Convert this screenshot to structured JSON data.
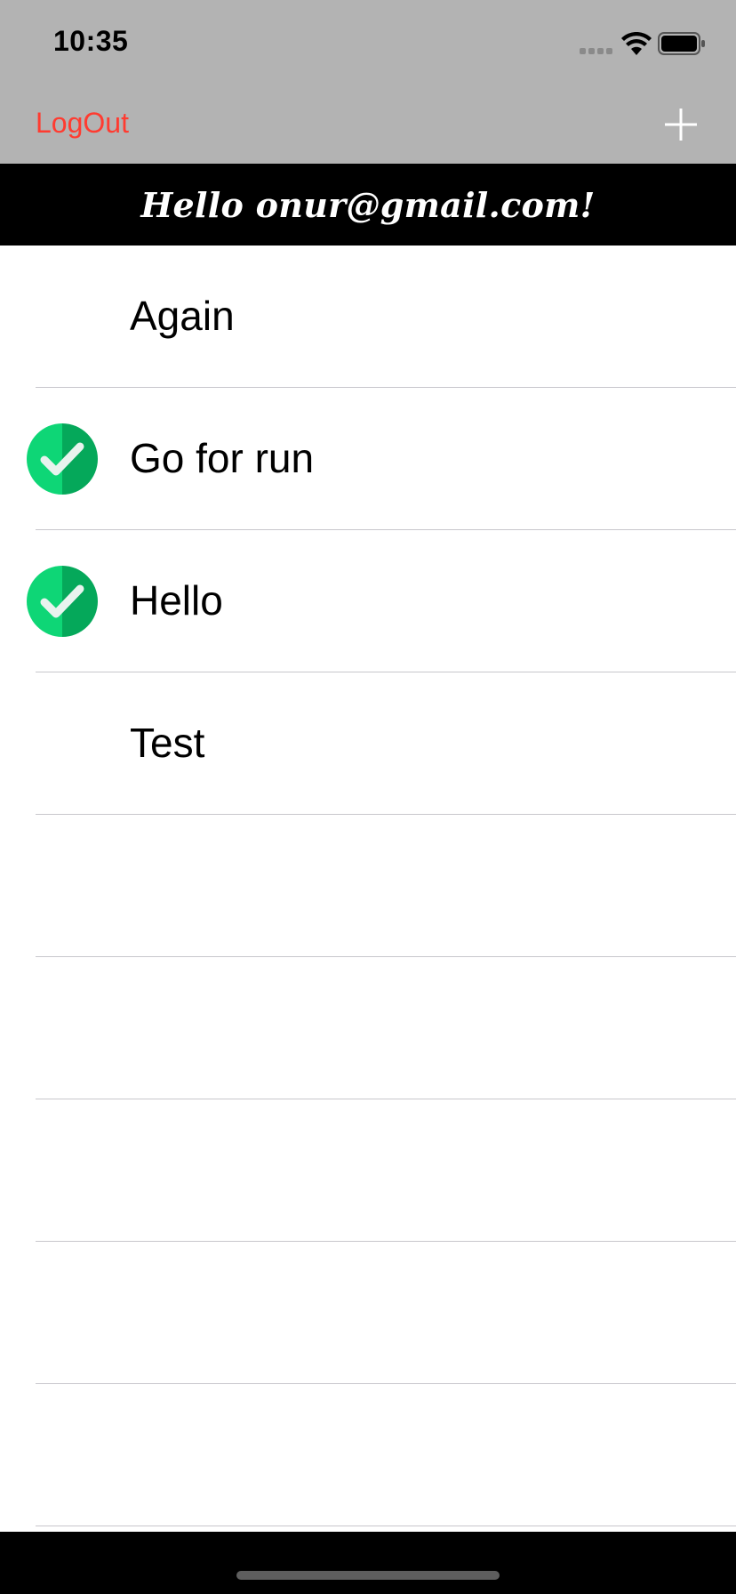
{
  "status_bar": {
    "time": "10:35",
    "wifi_icon": "wifi-icon",
    "battery_icon": "battery-icon",
    "signal_icon": "cellular-signal-icon"
  },
  "nav_bar": {
    "logout_label": "LogOut",
    "add_icon": "plus-icon"
  },
  "greeting": {
    "text": "Hello onur@gmail.com!"
  },
  "todos": [
    {
      "title": "Again",
      "done": false
    },
    {
      "title": "Go for run",
      "done": true
    },
    {
      "title": "Hello",
      "done": true
    },
    {
      "title": "Test",
      "done": false
    },
    {
      "title": "",
      "done": false
    },
    {
      "title": "",
      "done": false
    },
    {
      "title": "",
      "done": false
    },
    {
      "title": "",
      "done": false
    },
    {
      "title": "",
      "done": false
    }
  ],
  "colors": {
    "nav_background": "#b3b3b3",
    "logout_color": "#ff3b30",
    "banner_background": "#000000",
    "check_light": "#0ed676",
    "check_dark": "#05a85a"
  }
}
